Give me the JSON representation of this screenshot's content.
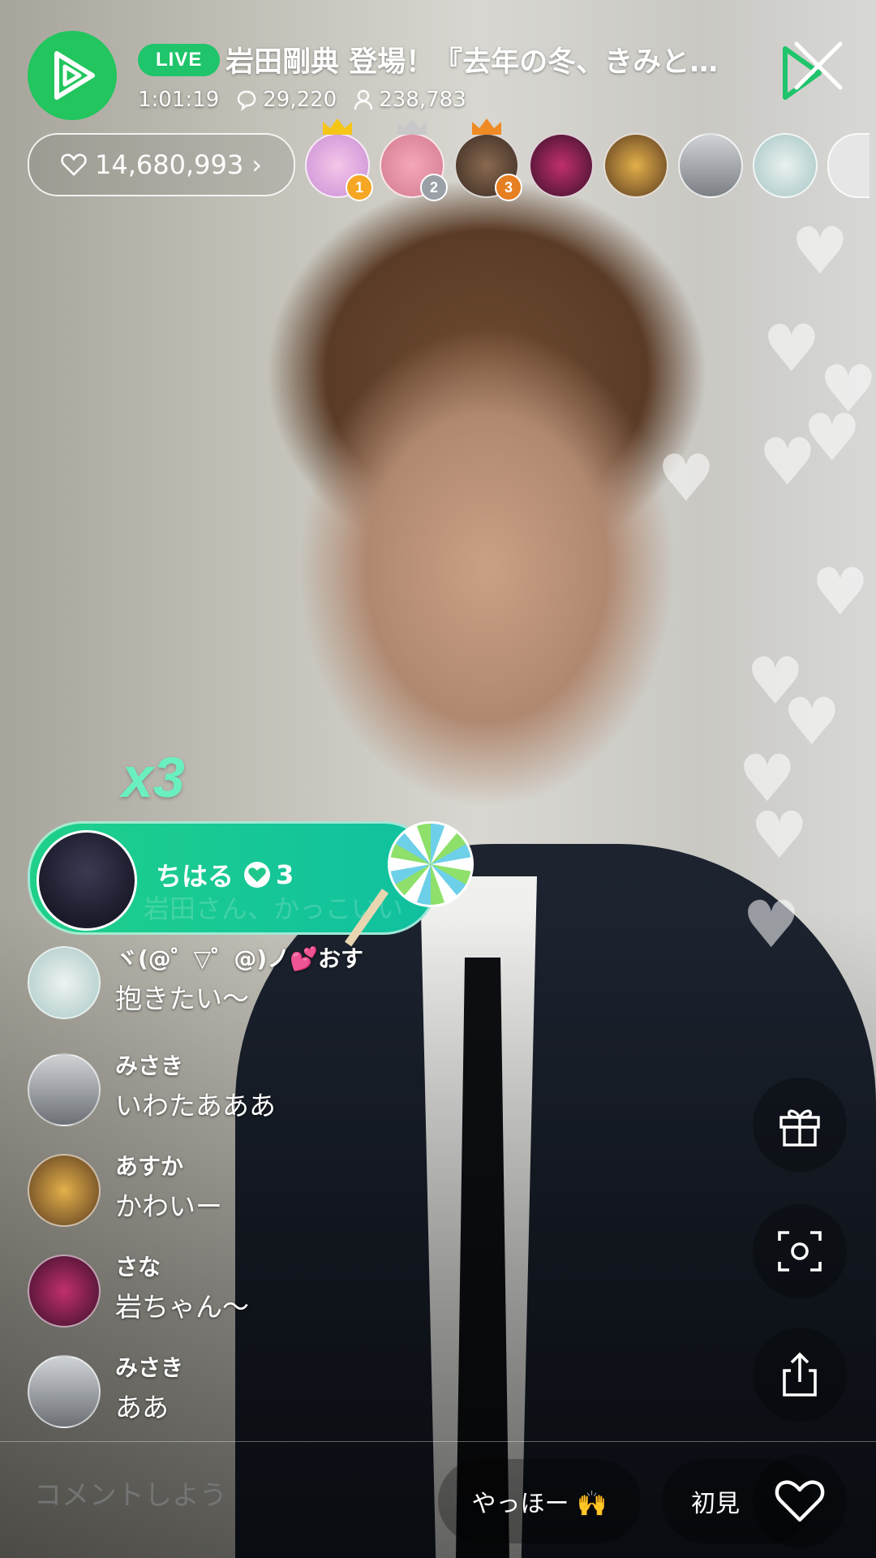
{
  "header": {
    "live_label": "LIVE",
    "title": "岩田剛典 登場！『去年の冬、きみと…",
    "elapsed": "1:01:19",
    "comment_count": "29,220",
    "viewer_count": "238,783"
  },
  "likes": {
    "count": "14,680,993",
    "chevron": "›"
  },
  "top_viewers": [
    {
      "rank": "1",
      "rank_color": "#f5a623",
      "crown_color": "#f5c518"
    },
    {
      "rank": "2",
      "rank_color": "#9aa0a6",
      "crown_color": "#c8c8c8"
    },
    {
      "rank": "3",
      "rank_color": "#e67e22",
      "crown_color": "#f08a24"
    }
  ],
  "gift": {
    "combo": "x3",
    "user": "ちはる",
    "hearts": "3",
    "overlay_text": "岩田さん、かっこいい"
  },
  "comments": [
    {
      "name": "ヾ(@゜▽゜@)ノ💕おす",
      "text": "抱きたい〜"
    },
    {
      "name": "みさき",
      "text": "いわたあああ"
    },
    {
      "name": "あすか",
      "text": "かわいー"
    },
    {
      "name": "さな",
      "text": "岩ちゃん〜"
    },
    {
      "name": "みさき",
      "text": "ああ"
    }
  ],
  "input": {
    "placeholder": "コメントしよう"
  },
  "quick_replies": [
    {
      "label": "やっほー 🙌"
    },
    {
      "label": "初見"
    }
  ],
  "colors": {
    "accent": "#1fc46b",
    "gift_gradient_start": "#1fd08a",
    "gift_gradient_end": "#10c0a0"
  }
}
